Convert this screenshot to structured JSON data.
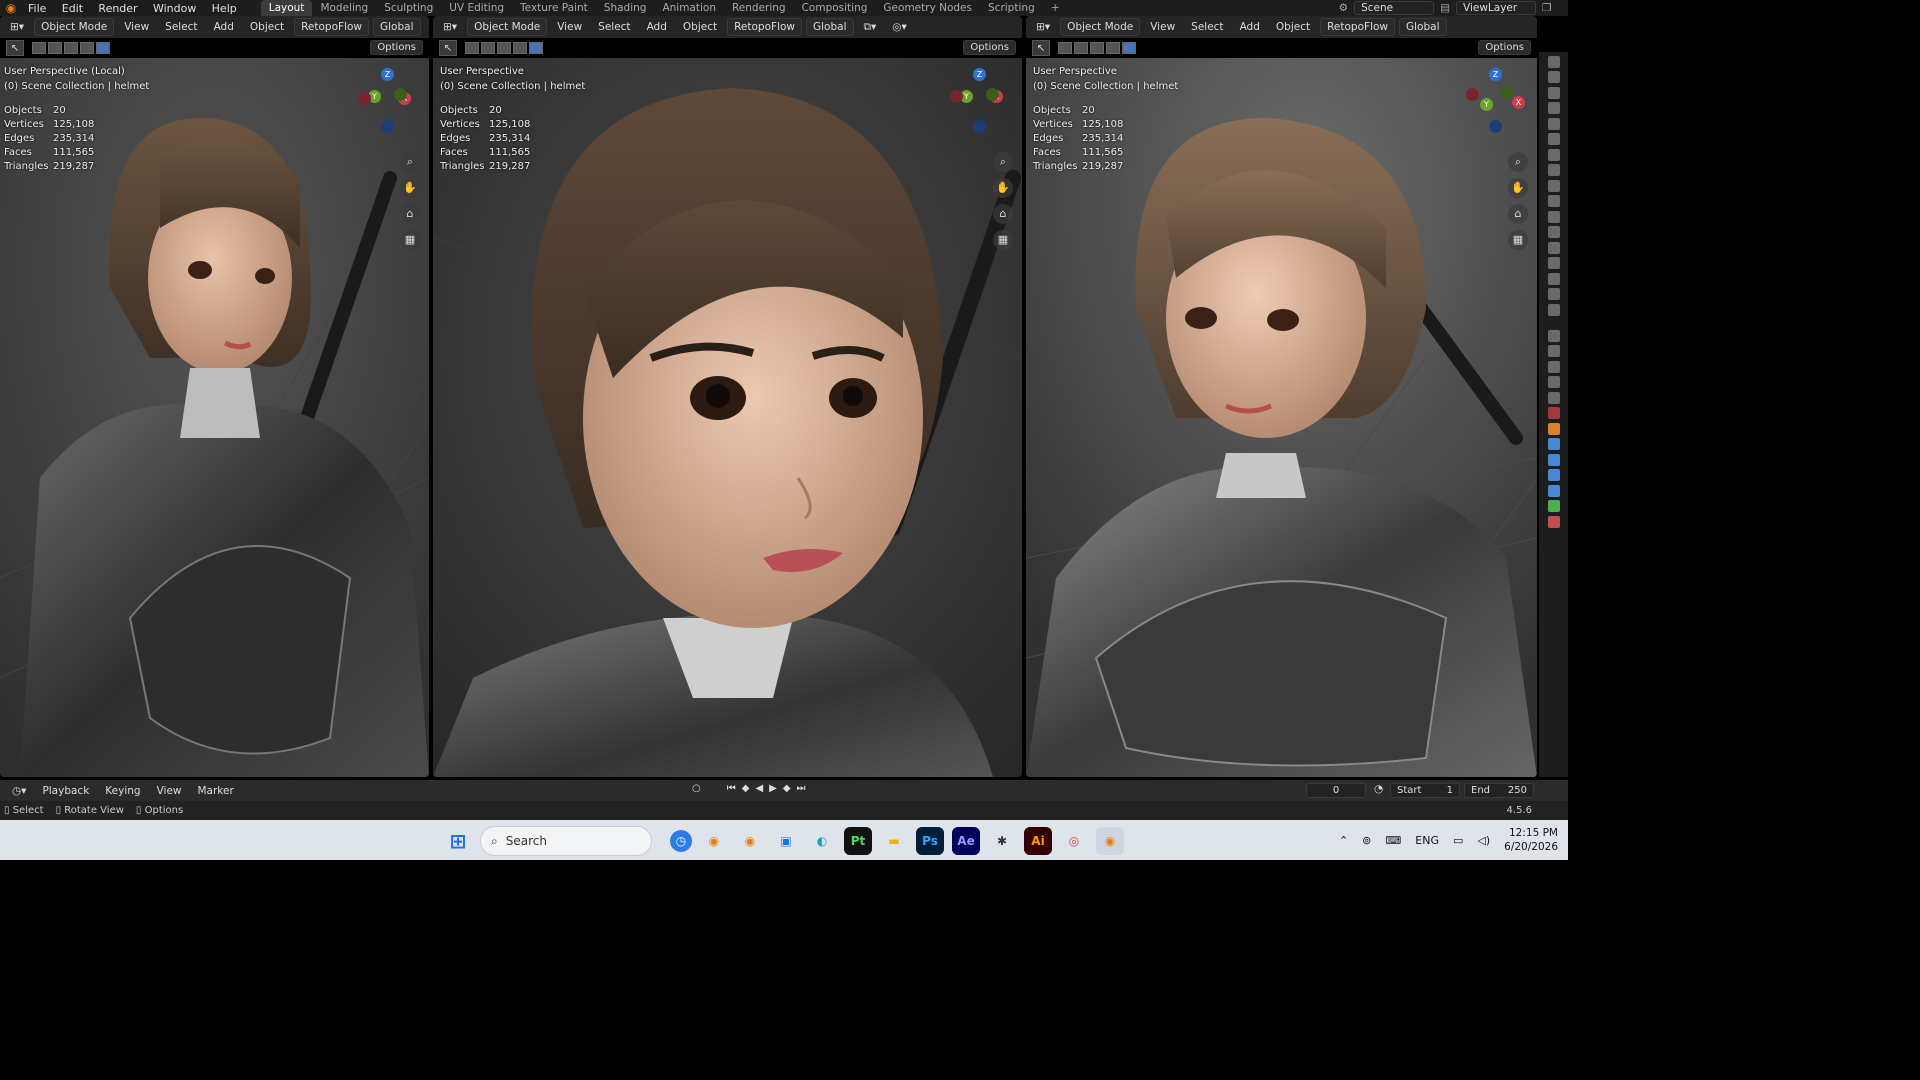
{
  "topbar": {
    "menu": [
      "File",
      "Edit",
      "Render",
      "Window",
      "Help"
    ],
    "workspaces": [
      "Layout",
      "Modeling",
      "Sculpting",
      "UV Editing",
      "Texture Paint",
      "Shading",
      "Animation",
      "Rendering",
      "Compositing",
      "Geometry Nodes",
      "Scripting",
      "+"
    ],
    "active_workspace": "Layout",
    "scene": "Scene",
    "view_layer": "ViewLayer"
  },
  "viewport_header": {
    "mode": "Object Mode",
    "view": "View",
    "select": "Select",
    "add": "Add",
    "object": "Object",
    "addon": "RetopoFlow",
    "orientation": "Global",
    "options": "Options"
  },
  "viewports": [
    {
      "perspective": "User Perspective (Local)",
      "collection": "(0) Scene Collection | helmet"
    },
    {
      "perspective": "User Perspective",
      "collection": "(0) Scene Collection | helmet"
    },
    {
      "perspective": "User Perspective",
      "collection": "(0) Scene Collection | helmet"
    }
  ],
  "stats": [
    {
      "k": "Objects",
      "v": "20"
    },
    {
      "k": "Vertices",
      "v": "125,108"
    },
    {
      "k": "Edges",
      "v": "235,314"
    },
    {
      "k": "Faces",
      "v": "111,565"
    },
    {
      "k": "Triangles",
      "v": "219,287"
    }
  ],
  "timeline": {
    "playback": "Playback",
    "keying": "Keying",
    "view": "View",
    "marker": "Marker",
    "current_frame": "0",
    "start_label": "Start",
    "start": "1",
    "end_label": "End",
    "end": "250"
  },
  "statusbar": {
    "select": "Select",
    "rotate": "Rotate View",
    "options": "Options",
    "version": "4.5.6"
  },
  "taskbar": {
    "search": "Search",
    "lang": "ENG",
    "time": "12:15 PM",
    "date": "6/20/2026"
  }
}
